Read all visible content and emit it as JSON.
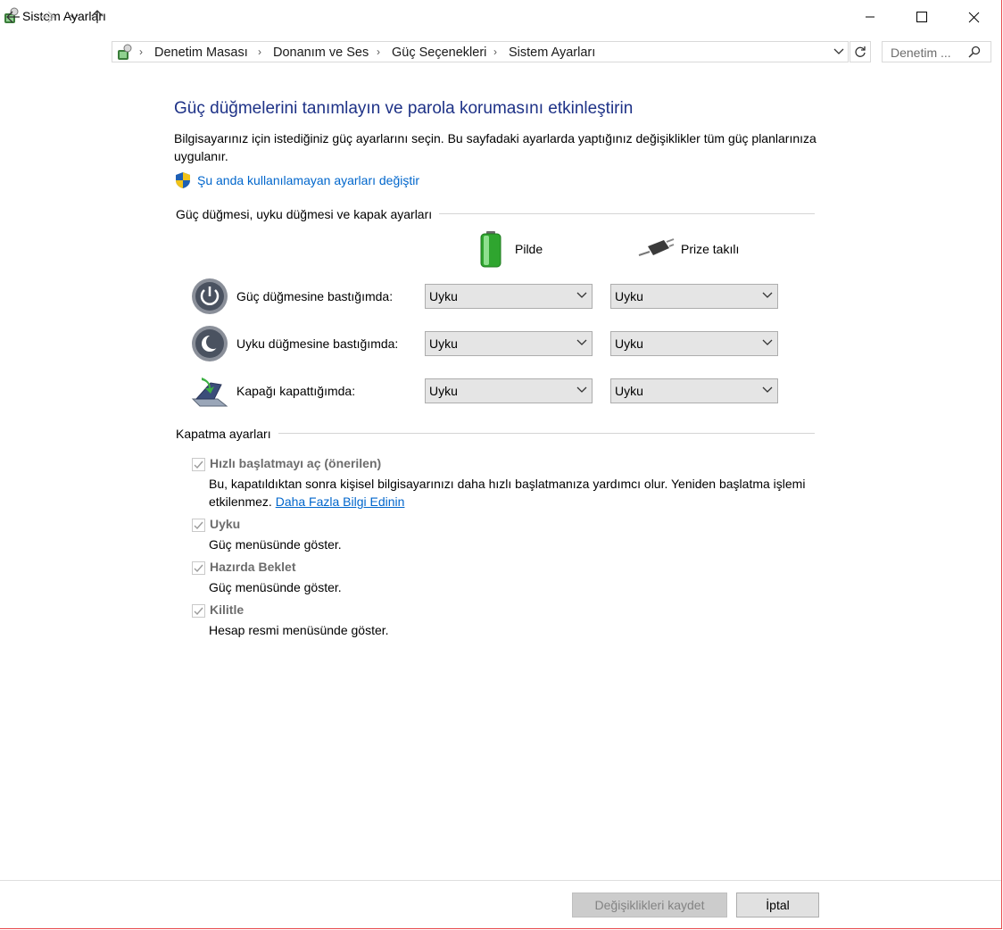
{
  "window": {
    "title": "Sistem Ayarları"
  },
  "address": {
    "crumbs": [
      "Denetim Masası",
      "Donanım ve Ses",
      "Güç Seçenekleri",
      "Sistem Ayarları"
    ],
    "search_placeholder": "Denetim ..."
  },
  "content": {
    "heading": "Güç düğmelerini tanımlayın ve parola korumasını etkinleştirin",
    "intro": "Bilgisayarınız için istediğiniz güç ayarlarını seçin. Bu sayfadaki ayarlarda yaptığınız değişiklikler tüm güç planlarınıza uygulanır.",
    "change_link": "Şu anda kullanılamayan ayarları değiştir"
  },
  "power_section": {
    "title": "Güç düğmesi, uyku düğmesi ve kapak ayarları",
    "col_battery": "Pilde",
    "col_plugged": "Prize takılı",
    "rows": [
      {
        "label": "Güç düğmesine bastığımda:",
        "battery": "Uyku",
        "plugged": "Uyku"
      },
      {
        "label": "Uyku düğmesine bastığımda:",
        "battery": "Uyku",
        "plugged": "Uyku"
      },
      {
        "label": "Kapağı kapattığımda:",
        "battery": "Uyku",
        "plugged": "Uyku"
      }
    ]
  },
  "shutdown_section": {
    "title": "Kapatma ayarları",
    "items": [
      {
        "label": "Hızlı başlatmayı aç (önerilen)",
        "desc": "Bu, kapatıldıktan sonra kişisel bilgisayarınızı daha hızlı başlatmanıza yardımcı olur. Yeniden başlatma işlemi etkilenmez.",
        "link": "Daha Fazla Bilgi Edinin",
        "checked": true
      },
      {
        "label": "Uyku",
        "desc": "Güç menüsünde göster.",
        "checked": true
      },
      {
        "label": "Hazırda Beklet",
        "desc": "Güç menüsünde göster.",
        "checked": true
      },
      {
        "label": "Kilitle",
        "desc": "Hesap resmi menüsünde göster.",
        "checked": true
      }
    ]
  },
  "footer": {
    "save": "Değişiklikleri kaydet",
    "cancel": "İptal"
  }
}
